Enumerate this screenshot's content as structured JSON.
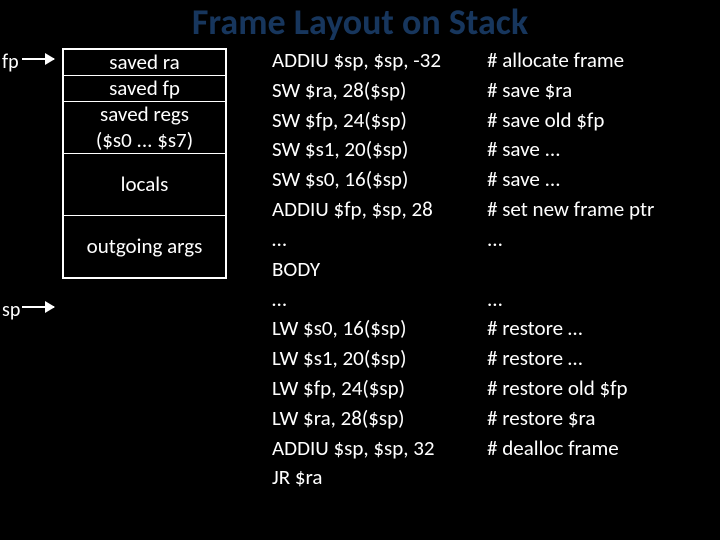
{
  "title": "Frame Layout on Stack",
  "pointers": {
    "fp": "fp",
    "sp": "sp"
  },
  "stack": {
    "cells": [
      "saved ra",
      "saved fp",
      "saved regs",
      "($s0 ... $s7)",
      "locals",
      "outgoing args"
    ]
  },
  "code": [
    {
      "instr": "ADDIU $sp, $sp, -32",
      "comment": "# allocate frame"
    },
    {
      "instr": "SW $ra, 28($sp)",
      "comment": "# save $ra"
    },
    {
      "instr": "SW $fp, 24($sp)",
      "comment": "# save old $fp"
    },
    {
      "instr": "SW $s1, 20($sp)",
      "comment": "# save ..."
    },
    {
      "instr": "SW $s0, 16($sp)",
      "comment": "# save ..."
    },
    {
      "instr": "ADDIU $fp, $sp, 28",
      "comment": "# set new frame ptr"
    },
    {
      "instr": "…",
      "comment": "..."
    },
    {
      "instr": "BODY",
      "comment": ""
    },
    {
      "instr": "…",
      "comment": "..."
    },
    {
      "instr": "LW $s0, 16($sp)",
      "comment": "# restore …"
    },
    {
      "instr": "LW $s1, 20($sp)",
      "comment": "# restore …"
    },
    {
      "instr": "LW $fp, 24($sp)",
      "comment": "# restore old $fp"
    },
    {
      "instr": "LW $ra, 28($sp)",
      "comment": "# restore $ra"
    },
    {
      "instr": "ADDIU $sp, $sp, 32",
      "comment": "# dealloc frame"
    },
    {
      "instr": "JR $ra",
      "comment": ""
    }
  ]
}
